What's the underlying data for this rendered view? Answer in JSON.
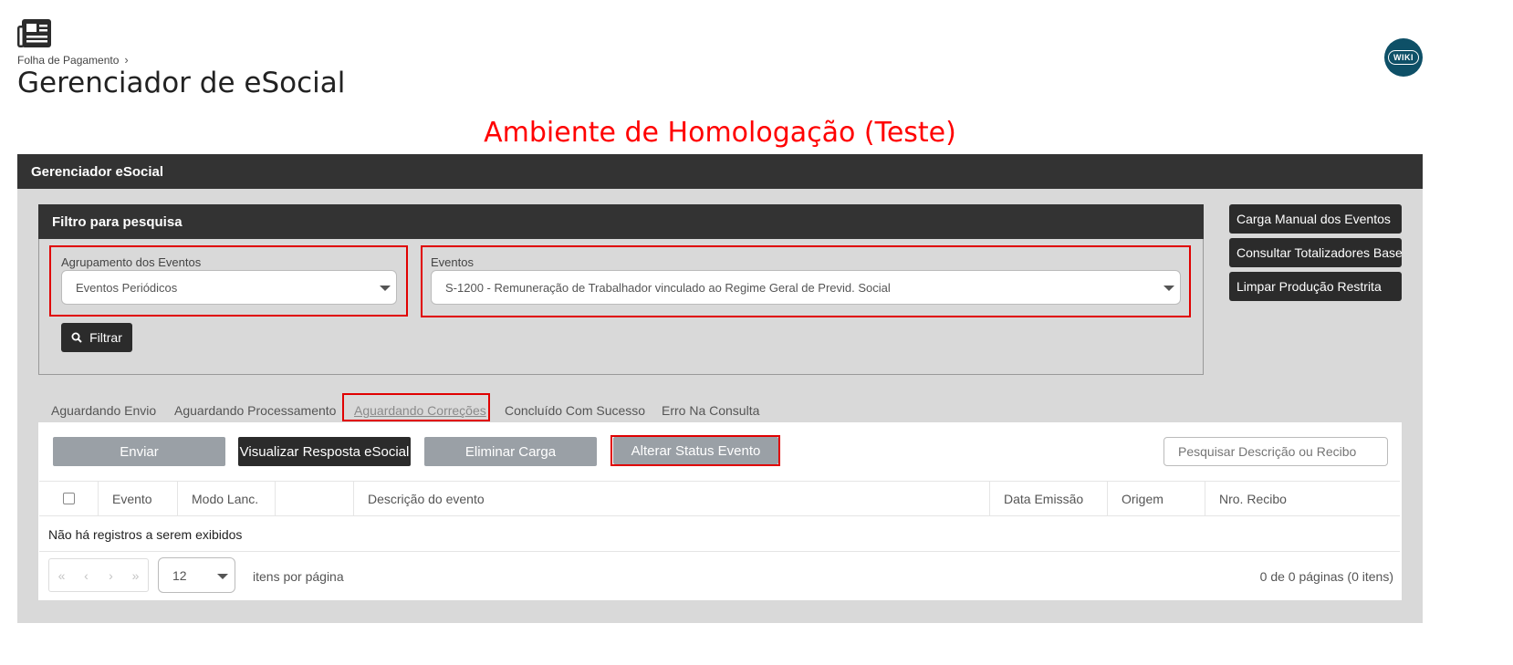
{
  "header": {
    "icon": "newspaper-icon",
    "breadcrumb": "Folha de Pagamento",
    "title": "Gerenciador de eSocial",
    "wiki_label": "WIKI"
  },
  "environment_banner": "Ambiente de Homologação (Teste)",
  "panel": {
    "title": "Gerenciador eSocial",
    "filter": {
      "title": "Filtro para pesquisa",
      "grouping_label": "Agrupamento dos Eventos",
      "grouping_value": "Eventos Periódicos",
      "events_label": "Eventos",
      "events_value": "S-1200 - Remuneração de Trabalhador vinculado ao Regime Geral de Previd. Social",
      "filter_button": "Filtrar"
    },
    "side_buttons": [
      "Carga Manual dos Eventos",
      "Consultar Totalizadores Base",
      "Limpar Produção Restrita"
    ],
    "tabs": [
      "Aguardando Envio",
      "Aguardando Processamento",
      "Aguardando Correções",
      "Concluído Com Sucesso",
      "Erro Na Consulta"
    ],
    "actions": {
      "send": "Enviar",
      "view_response": "Visualizar Resposta eSocial",
      "delete_load": "Eliminar Carga",
      "change_status": "Alterar Status Evento"
    },
    "search_placeholder": "Pesquisar Descrição ou Recibo",
    "table": {
      "columns": [
        "Evento",
        "Modo Lanc.",
        "",
        "Descrição do evento",
        "Data Emissão",
        "Origem",
        "Nro. Recibo"
      ],
      "empty_message": "Não há registros a serem exibidos"
    },
    "pagination": {
      "per_page_value": "12",
      "per_page_label": "itens por página",
      "info": "0 de 0 páginas (0 itens)"
    }
  },
  "colors": {
    "dark_header": "#333333",
    "panel_bg": "#d9d9d9",
    "highlight": "#e00000",
    "banner_text": "#ff0000",
    "wiki_bg": "#0e5067"
  }
}
